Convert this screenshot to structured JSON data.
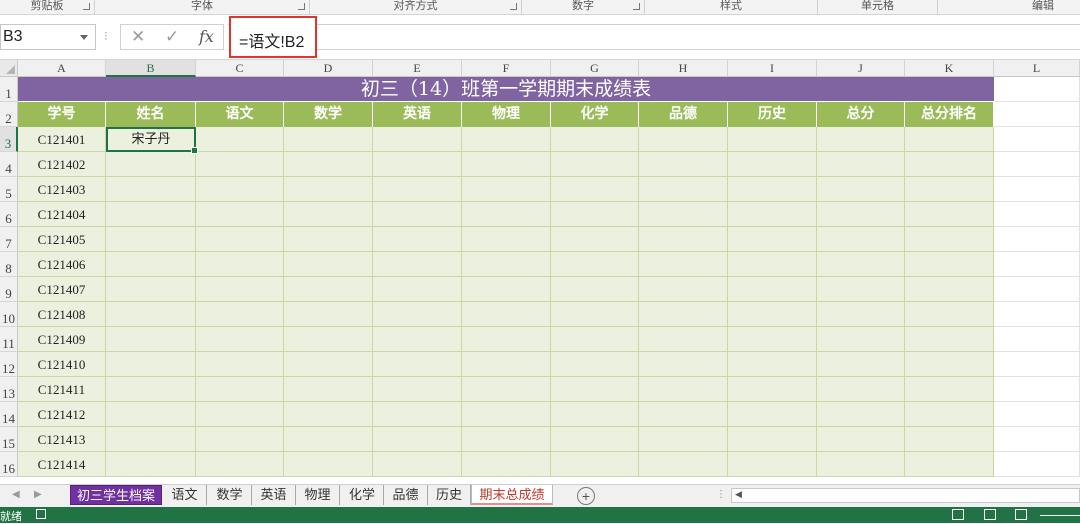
{
  "ribbon": {
    "groups": [
      "剪贴板",
      "字体",
      "对齐方式",
      "数字",
      "样式",
      "单元格",
      "编辑"
    ]
  },
  "formula_bar": {
    "name_box": "B3",
    "cancel_icon": "✕",
    "enter_icon": "✓",
    "fx_label": "fx",
    "formula": "=语文!B2"
  },
  "grid": {
    "columns": [
      "A",
      "B",
      "C",
      "D",
      "E",
      "F",
      "G",
      "H",
      "I",
      "J",
      "K",
      "L"
    ],
    "rows": [
      "1",
      "2",
      "3",
      "4",
      "5",
      "6",
      "7",
      "8",
      "9",
      "10",
      "11",
      "12",
      "13",
      "14",
      "15",
      "16"
    ],
    "selected_column": "B",
    "selected_row": "3",
    "title": "初三（14）班第一学期期末成绩表",
    "headers": [
      "学号",
      "姓名",
      "语文",
      "数学",
      "英语",
      "物理",
      "化学",
      "品德",
      "历史",
      "总分",
      "总分排名"
    ],
    "student_ids": [
      "C121401",
      "C121402",
      "C121403",
      "C121404",
      "C121405",
      "C121406",
      "C121407",
      "C121408",
      "C121409",
      "C121410",
      "C121411",
      "C121412",
      "C121413",
      "C121414"
    ],
    "active_cell_value": "宋子丹"
  },
  "sheet_tabs": {
    "tabs": [
      "初三学生档案",
      "语文",
      "数学",
      "英语",
      "物理",
      "化学",
      "品德",
      "历史",
      "期末总成绩"
    ],
    "active": "期末总成绩",
    "add_label": "+"
  },
  "status_bar": {
    "ready": "就绪"
  },
  "colors": {
    "title_fill": "#8064a2",
    "header_fill": "#9bbb59",
    "data_fill": "#ebf1de",
    "excel_green": "#217346",
    "highlight_red": "#e0352b"
  }
}
